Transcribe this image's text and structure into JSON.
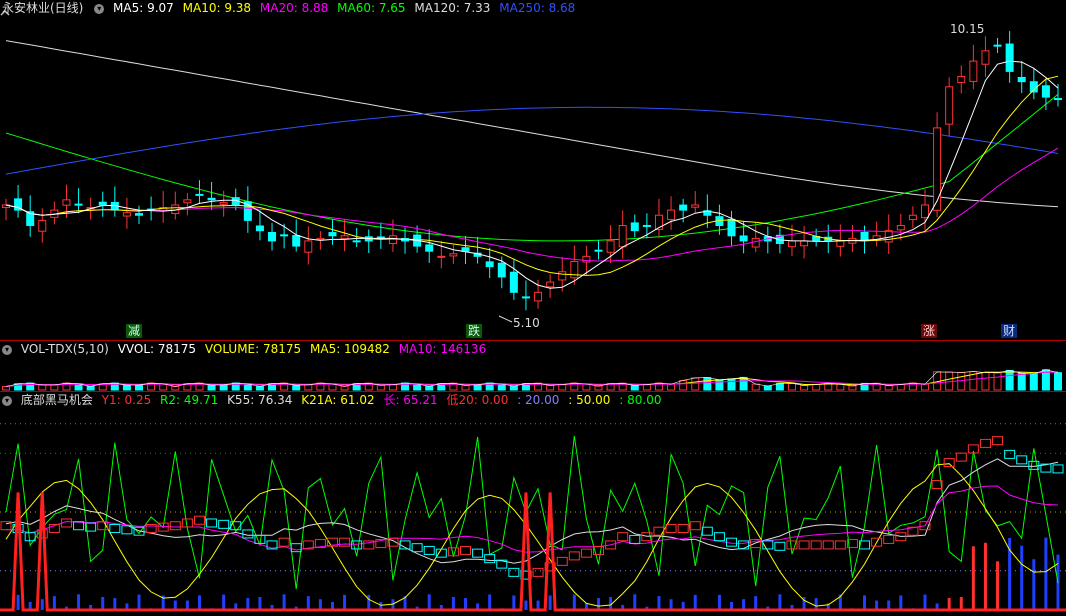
{
  "main_header": {
    "title": "永安林业(日线)",
    "ma5": "MA5: 9.07",
    "ma10": "MA10: 9.38",
    "ma20": "MA20: 8.88",
    "ma60": "MA60: 7.65",
    "ma120": "MA120: 7.33",
    "ma250": "MA250: 8.68"
  },
  "price_labels": {
    "high": "10.15",
    "low": "5.10"
  },
  "markers": {
    "m1": "减",
    "m2": "跌",
    "m3": "涨",
    "m4": "财"
  },
  "vol_header": {
    "name": "VOL-TDX(5,10)",
    "vvol": "VVOL: 78175",
    "volume": "VOLUME: 78175",
    "ma5": "MA5: 109482",
    "ma10": "MA10: 146136"
  },
  "ind_header": {
    "name": "底部黑马机会",
    "y1": "Y1: 0.25",
    "r2": "R2: 49.71",
    "k55": "K55: 76.34",
    "k21a": "K21A: 61.02",
    "chang": "长: 65.21",
    "di20": "低20: 0.00",
    "l20": ": 20.00",
    "l50": ": 50.00",
    "l80": ": 80.00"
  },
  "colors": {
    "ma5": "#ffffff",
    "ma10": "#ffff00",
    "ma20": "#ff00ff",
    "ma60": "#00ff00",
    "ma120": "#dddddd",
    "ma250": "#3050ff",
    "up": "#ff3333",
    "down": "#00ffff",
    "vvol": "#ffffff",
    "volma5": "#ffff00",
    "volma10": "#ff00ff"
  },
  "chart_data": [
    {
      "type": "candlestick",
      "title": "永安林业(日线)",
      "series": [
        {
          "name": "MA5",
          "last": 9.07
        },
        {
          "name": "MA10",
          "last": 9.38
        },
        {
          "name": "MA20",
          "last": 8.88
        },
        {
          "name": "MA60",
          "last": 7.65
        },
        {
          "name": "MA120",
          "last": 7.33
        },
        {
          "name": "MA250",
          "last": 8.68
        }
      ],
      "annotations": [
        {
          "label": "10.15",
          "kind": "high"
        },
        {
          "label": "5.10",
          "kind": "low"
        }
      ],
      "closes": [
        7.0,
        6.9,
        6.6,
        6.7,
        6.9,
        7.1,
        7.0,
        6.95,
        7.0,
        6.9,
        6.85,
        6.8,
        6.9,
        6.95,
        7.0,
        7.1,
        7.2,
        7.1,
        7.05,
        7.0,
        6.7,
        6.5,
        6.3,
        6.4,
        6.2,
        6.3,
        6.35,
        6.4,
        6.4,
        6.3,
        6.3,
        6.35,
        6.4,
        6.3,
        6.2,
        6.1,
        6.0,
        6.05,
        6.1,
        6.0,
        5.8,
        5.6,
        5.3,
        5.2,
        5.3,
        5.5,
        5.7,
        5.9,
        6.0,
        6.1,
        6.3,
        6.6,
        6.5,
        6.6,
        6.8,
        6.9,
        6.9,
        7.0,
        6.8,
        6.6,
        6.4,
        6.3,
        6.35,
        6.3,
        6.25,
        6.3,
        6.3,
        6.3,
        6.3,
        6.3,
        6.35,
        6.3,
        6.4,
        6.5,
        6.6,
        6.8,
        7.0,
        8.5,
        9.3,
        9.5,
        9.8,
        10.0,
        10.1,
        9.6,
        9.4,
        9.2,
        9.1,
        9.07
      ]
    },
    {
      "type": "bar",
      "title": "VOL-TDX(5,10)",
      "series": [
        {
          "name": "VVOL",
          "last": 78175
        },
        {
          "name": "VOLUME",
          "last": 78175
        },
        {
          "name": "MA5",
          "last": 109482
        },
        {
          "name": "MA10",
          "last": 146136
        }
      ]
    },
    {
      "type": "line",
      "title": "底部黑马机会",
      "series": [
        {
          "name": "Y1",
          "last": 0.25
        },
        {
          "name": "R2",
          "last": 49.71
        },
        {
          "name": "K55",
          "last": 76.34
        },
        {
          "name": "K21A",
          "last": 61.02
        },
        {
          "name": "长",
          "last": 65.21
        },
        {
          "name": "低20",
          "last": 0.0
        }
      ],
      "reference_lines": [
        20.0,
        50.0,
        80.0
      ]
    }
  ]
}
